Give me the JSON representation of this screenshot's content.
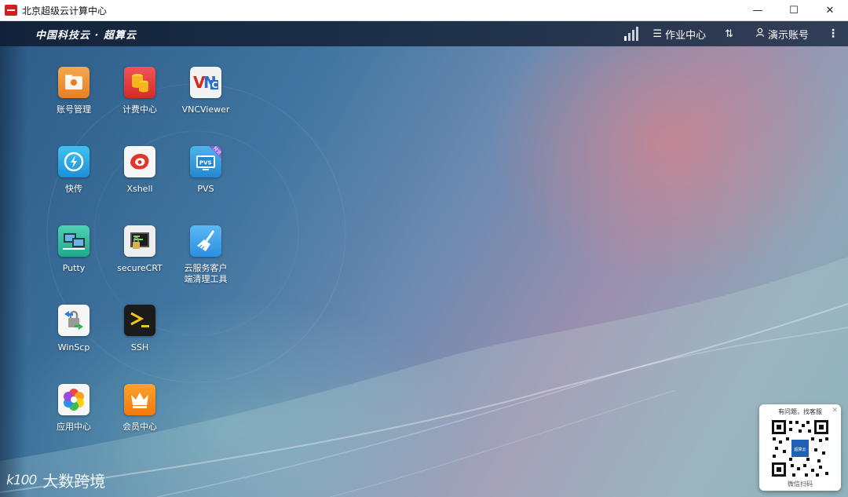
{
  "window": {
    "title": "北京超级云计算中心",
    "minimize_glyph": "—",
    "maximize_glyph": "☐",
    "close_glyph": "✕"
  },
  "topbar": {
    "brand": "中国科技云 · 超算云",
    "signal_icon": "signal-icon",
    "jobs_label": "作业中心",
    "transfer_icon": "transfer-arrows-icon",
    "account_label": "演示账号",
    "more_icon": "more-vertical-icon"
  },
  "apps": [
    {
      "label": "账号管理",
      "icon": "folder-account-icon"
    },
    {
      "label": "计费中心",
      "icon": "coins-billing-icon"
    },
    {
      "label": "VNCViewer",
      "icon": "vnc-icon"
    },
    {
      "label": "快传",
      "icon": "fast-transfer-icon"
    },
    {
      "label": "Xshell",
      "icon": "xshell-icon"
    },
    {
      "label": "PVS",
      "icon": "pvs-icon",
      "badge": "预览"
    },
    {
      "label": "Putty",
      "icon": "putty-icon"
    },
    {
      "label": "secureCRT",
      "icon": "securecrt-icon"
    },
    {
      "label1": "云服务客户",
      "label2": "端清理工具",
      "icon": "broom-icon"
    },
    {
      "label": "WinScp",
      "icon": "winscp-icon"
    },
    {
      "label": "SSH",
      "icon": "terminal-icon"
    },
    {
      "label": "应用中心",
      "icon": "app-center-icon"
    },
    {
      "label": "会员中心",
      "icon": "crown-icon"
    }
  ],
  "qr_panel": {
    "title": "有问题，找客服",
    "footer": "微信扫码",
    "close_glyph": "✕",
    "center_text": "超算云"
  },
  "watermark": {
    "logo_text": "k100",
    "text": "大数跨境"
  },
  "colors": {
    "topbar_bg": "#14233a",
    "titlebar_bg": "#ffffff",
    "brand_red": "#d21f1f"
  }
}
